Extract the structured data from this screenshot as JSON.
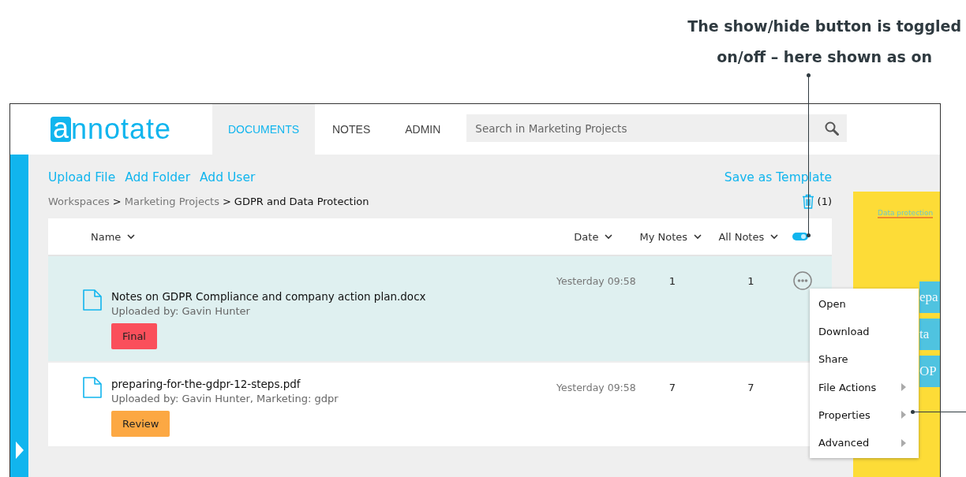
{
  "caption": {
    "lines": [
      "The show/hide button is toggled",
      "on/off – here shown as on"
    ]
  },
  "logo": {
    "mark": "a",
    "rest": "nnotate"
  },
  "tabs": [
    {
      "label": "DOCUMENTS",
      "selected": true
    },
    {
      "label": "NOTES",
      "selected": false
    },
    {
      "label": "ADMIN",
      "selected": false
    }
  ],
  "search": {
    "placeholder": "Search in Marketing Projects"
  },
  "actions": [
    "Upload File",
    "Add Folder",
    "Add User"
  ],
  "save_template": "Save as Template",
  "breadcrumb": [
    {
      "label": "Workspaces",
      "current": false
    },
    {
      "label": "Marketing Projects",
      "current": false
    },
    {
      "label": "GDPR and Data Protection",
      "current": true
    }
  ],
  "breadcrumb_separator": ">",
  "trash_count": "(1)",
  "columns": [
    "Name",
    "Date",
    "My Notes",
    "All Notes"
  ],
  "notes_toggle": {
    "on": true
  },
  "rows": [
    {
      "name": "Notes on GDPR Compliance and company action plan.docx",
      "uploaded": "Uploaded by: Gavin Hunter",
      "tag": {
        "label": "Final",
        "color": "#fa4f5b"
      },
      "date": "Yesterday 09:58",
      "my_notes": "1",
      "all_notes": "1",
      "selected": true
    },
    {
      "name": "preparing-for-the-gdpr-12-steps.pdf",
      "uploaded": "Uploaded by: Gavin Hunter, Marketing: gdpr",
      "tag": {
        "label": "Review",
        "color": "#fca843"
      },
      "date": "Yesterday 09:58",
      "my_notes": "7",
      "all_notes": "7",
      "selected": false
    }
  ],
  "context_menu": [
    {
      "label": "Open",
      "submenu": false
    },
    {
      "label": "Download",
      "submenu": false
    },
    {
      "label": "Share",
      "submenu": false
    },
    {
      "label": "File Actions",
      "submenu": true
    },
    {
      "label": "Properties",
      "submenu": true
    },
    {
      "label": "Advanced",
      "submenu": true
    }
  ],
  "preview": {
    "highlight": "Data protection",
    "blocks": [
      "epa",
      "ta",
      "OP"
    ]
  }
}
